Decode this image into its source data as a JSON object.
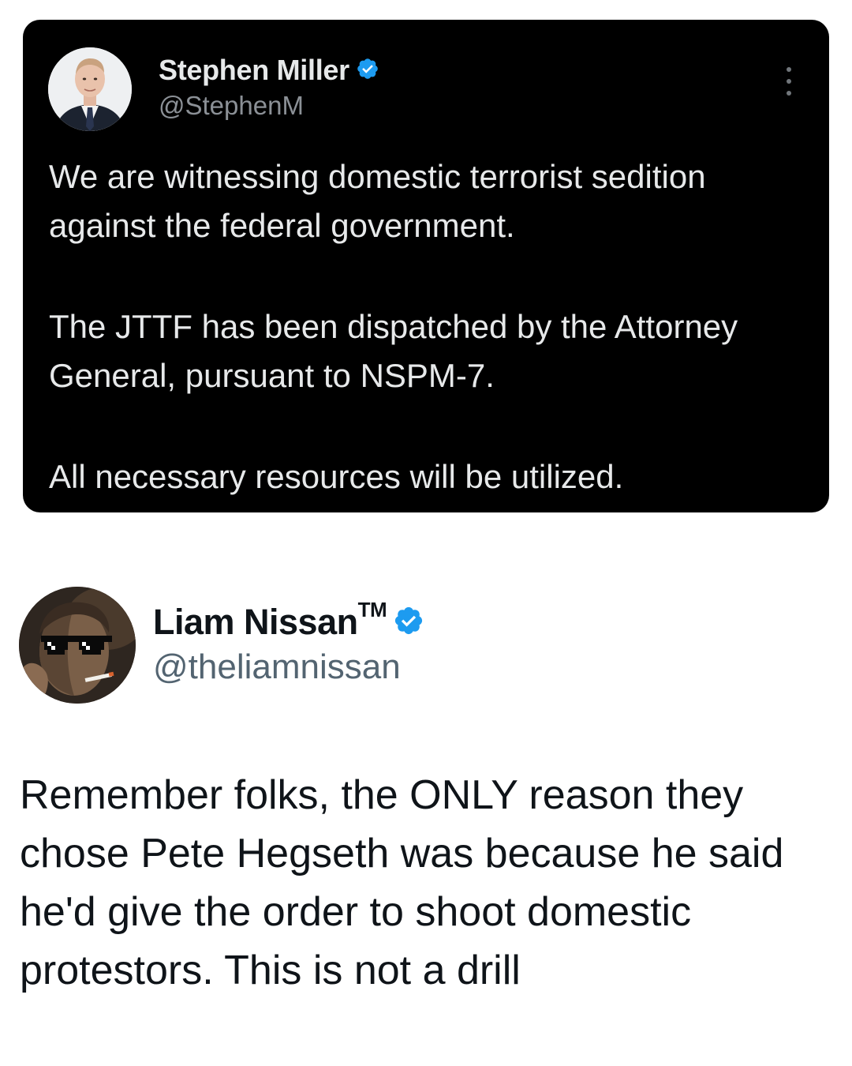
{
  "quoted_tweet": {
    "author_name": "Stephen Miller",
    "handle": "@StephenM",
    "verified": true,
    "verified_color": "#1d9bf0",
    "background": "#000000",
    "paragraphs": [
      "We are witnessing domestic terrorist sedition against the federal government.",
      "The JTTF has been dispatched by the Attorney General, pursuant to NSPM-7.",
      "All necessary resources will be utilized."
    ],
    "more_icon": "more-vertical-icon"
  },
  "tweet": {
    "author_name": "Liam Nissan",
    "author_name_suffix": "TM",
    "handle": "@theliamnissan",
    "verified": true,
    "verified_color": "#1d9bf0",
    "text": "Remember folks, the ONLY reason they chose Pete Hegseth was because he said he'd give the order to shoot domestic protestors. This is not a drill"
  }
}
